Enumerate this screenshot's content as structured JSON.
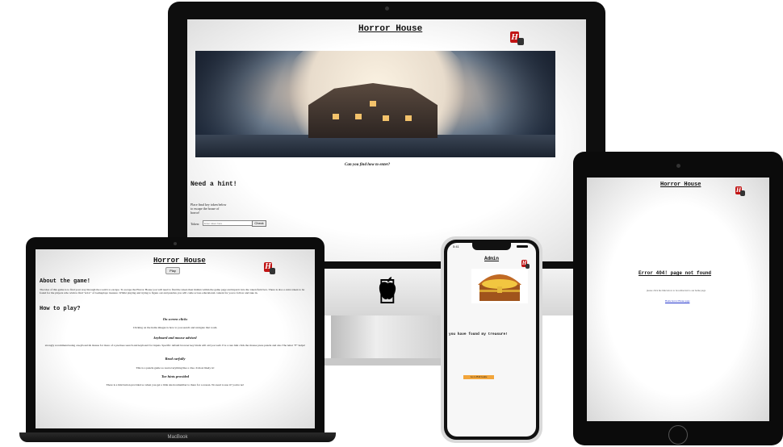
{
  "imac": {
    "title": "Horror House",
    "logo_text": "H",
    "caption": "Can you find how to enter?",
    "hint_heading": "Need a hint!",
    "hint_text": "Place final key token below to escape the house of horror!",
    "token_label": "Token:",
    "token_placeholder": "Enter token here",
    "check_button": "Check"
  },
  "laptop": {
    "title": "Horror House",
    "play_button": "Play",
    "about_heading": "About the game!",
    "about_text": "The idea of this game is to find your way through the room's to escape. To escape the Horror House you will need to find the token then hidden within the game page and input it into the token field box. There is also a extra token to be found for the players who wish to find \"ALL\" of Gameplaye treasure. Whilst playing and trying to figure out and puzzles you will come across educational content for you to follow and take in.",
    "howto_heading": "How to play?",
    "sections": [
      {
        "heading": "On screen clicks",
        "text": "Clicking on the items images is how to you search and navigate that room."
      },
      {
        "heading": "keyboard and mouse advised",
        "text": "strongly recommend using a keyboard & mouse for more of a precisee search and keyboard for inputs. Specific default browser key binds will aid you well. I've a rare hint click the mouse press puzzle and also The letter \"F\" helps!"
      },
      {
        "heading": "Read carfully",
        "text": "This is a puzzle game so read everything like a clue. It most likely is!"
      },
      {
        "heading": "Toe hints provided",
        "text": "There is a hint button provided so when you get a little stuck remember to there for a reason. No need to use it? you're no!"
      }
    ],
    "brand_label": "MacBook"
  },
  "phone": {
    "time": "5:41",
    "title": "Admin",
    "found_text": "you have found my treasure!",
    "link_text": "Go to Hall Game"
  },
  "tablet": {
    "title": "Horror House",
    "error_heading": "Error 404! page not found",
    "error_text": "please click the link below to be redirected to our home page",
    "home_link": "Home horror House page"
  },
  "colors": {
    "logo_red": "#c11515",
    "device_black": "#0e0e0e",
    "phone_link_bg": "#f2a53a"
  }
}
